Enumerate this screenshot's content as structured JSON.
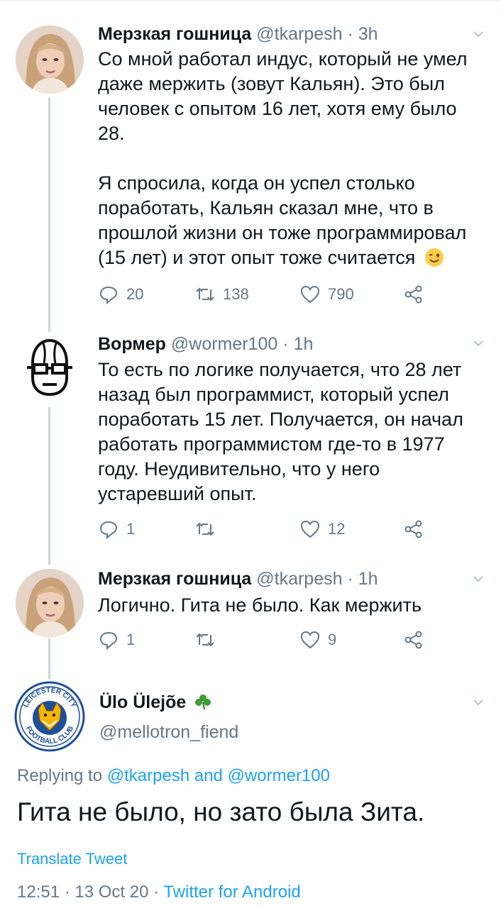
{
  "tweets": [
    {
      "name": "Мерзкая гошница",
      "handle": "@tkarpesh",
      "time": "3h",
      "text_p1": "Со мной работал индус, который не умел даже мержить (зовут Кальян).  Это был человек с опытом 16 лет, хотя ему было 28.",
      "text_p2": "Я спросила, когда он успел столько поработать, Кальян сказал мне, что в прошлой жизни он тоже программировал (15 лет) и этот опыт тоже считается",
      "emoji": "wink-emoji",
      "replies": "20",
      "retweets": "138",
      "likes": "790"
    },
    {
      "name": "Вормер",
      "handle": "@wormer100",
      "time": "1h",
      "text": "То есть по логике получается, что 28 лет назад был программист, который успел поработать 15 лет. Получается, он начал работать программистом где-то в 1977 году. Неудивительно, что у него устаревший опыт.",
      "replies": "1",
      "retweets": "",
      "likes": "12"
    },
    {
      "name": "Мерзкая гошница",
      "handle": "@tkarpesh",
      "time": "1h",
      "text": "Логично. Гита не было. Как мержить",
      "replies": "1",
      "retweets": "",
      "likes": "9"
    }
  ],
  "main_tweet": {
    "name": "Ülo Ülejõe",
    "name_emoji": "shamrock-emoji",
    "handle": "@mellotron_fiend",
    "replying_prefix": "Replying to",
    "replying_user1": "@tkarpesh",
    "replying_and": "and",
    "replying_user2": "@wormer100",
    "text": "Гита не было, но зато была Зита.",
    "translate": "Translate Tweet",
    "timestamp": "12:51 · 13 Oct 20 · ",
    "client": "Twitter for Android",
    "avatar_badge_top": "LEICESTER CITY",
    "avatar_badge_bottom": "FOOTBALL CLUB"
  },
  "colors": {
    "accent": "#1da1f2",
    "secondary_text": "#657786",
    "thread_line": "#ccd6dd"
  }
}
